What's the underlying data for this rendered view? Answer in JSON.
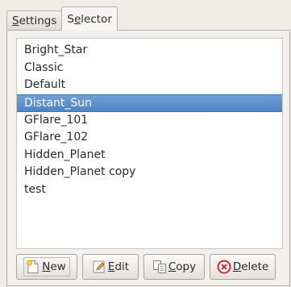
{
  "tabs": [
    {
      "mnemonic": "S",
      "rest": "ettings"
    },
    {
      "pre": "S",
      "mnemonic": "e",
      "rest": "lector"
    }
  ],
  "list": {
    "items": [
      "Bright_Star",
      "Classic",
      "Default",
      "Distant_Sun",
      "GFlare_101",
      "GFlare_102",
      "Hidden_Planet",
      "Hidden_Planet copy",
      "test"
    ],
    "selected": "Distant_Sun"
  },
  "buttons": {
    "new": {
      "mnemonic": "N",
      "rest": "ew",
      "icon": "new-document-icon"
    },
    "edit": {
      "mnemonic": "E",
      "rest": "dit",
      "icon": "edit-pencil-icon"
    },
    "copy": {
      "mnemonic": "C",
      "rest": "opy",
      "icon": "copy-icon"
    },
    "delete": {
      "mnemonic": "D",
      "rest": "elete",
      "icon": "delete-icon"
    }
  },
  "colors": {
    "selection": "#5a8dcb",
    "delete_icon": "#d8262a"
  }
}
